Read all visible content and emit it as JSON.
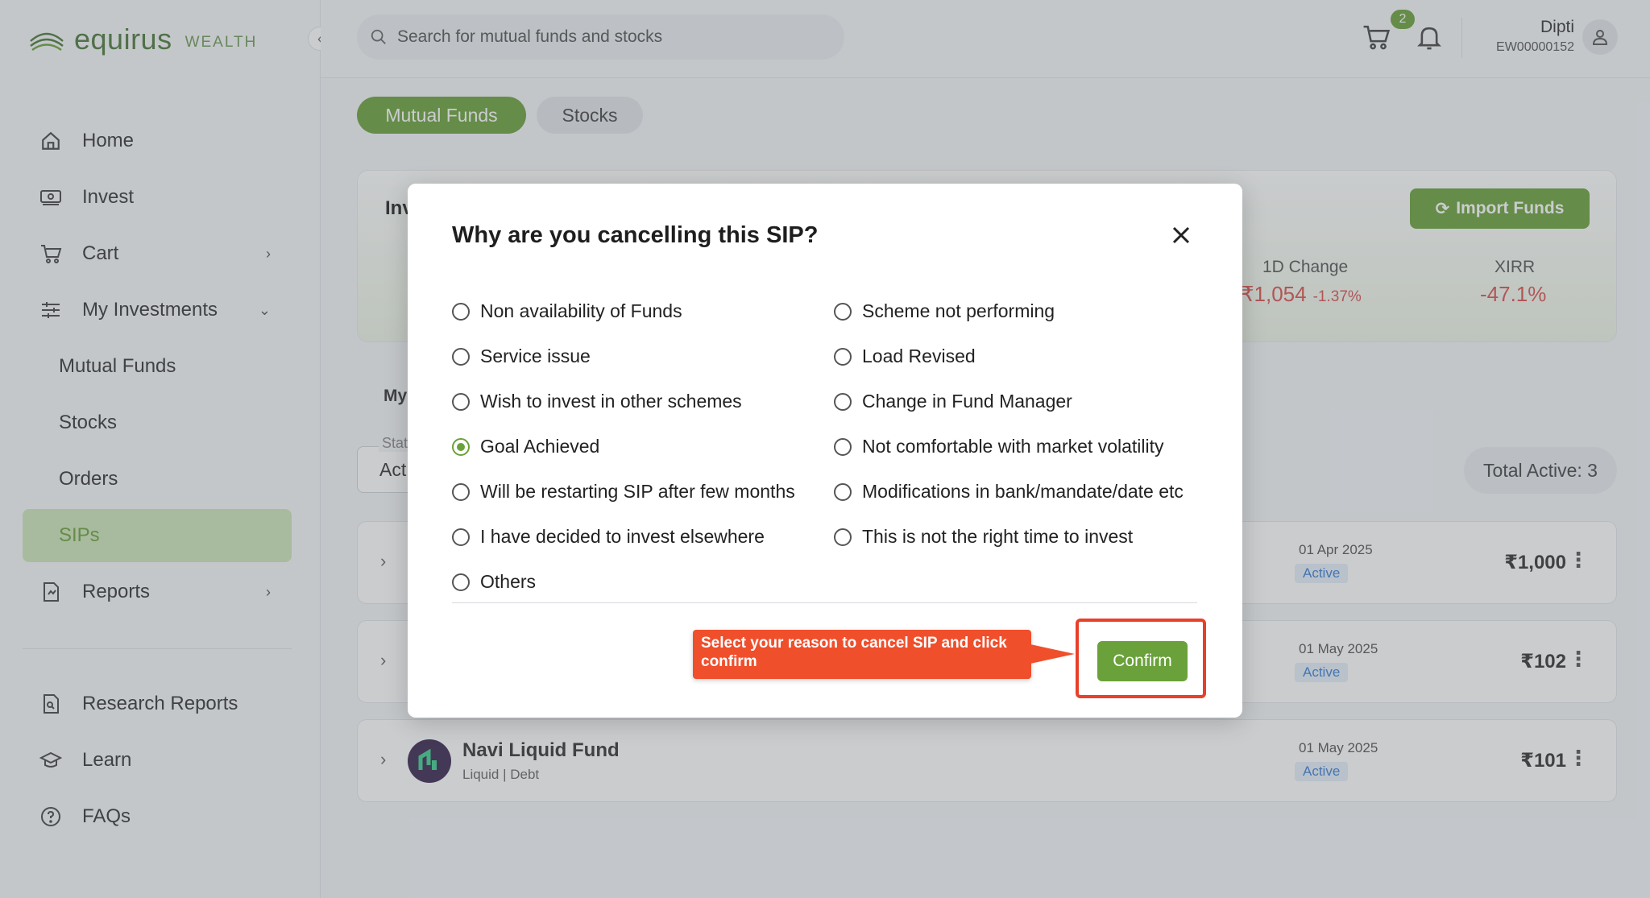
{
  "brand": {
    "name": "equirus",
    "suffix": "WEALTH"
  },
  "sidebar": {
    "items": [
      {
        "label": "Home",
        "icon": "home-icon"
      },
      {
        "label": "Invest",
        "icon": "invest-icon"
      },
      {
        "label": "Cart",
        "icon": "cart-icon"
      },
      {
        "label": "My Investments",
        "icon": "investments-icon"
      },
      {
        "label": "Reports",
        "icon": "reports-icon"
      },
      {
        "label": "Research Reports",
        "icon": "research-icon"
      },
      {
        "label": "Learn",
        "icon": "learn-icon"
      },
      {
        "label": "FAQs",
        "icon": "faq-icon"
      }
    ],
    "sub_items": [
      "Mutual Funds",
      "Stocks",
      "Orders",
      "SIPs"
    ],
    "active_sub": "SIPs"
  },
  "header": {
    "search_placeholder": "Search for mutual funds and stocks",
    "cart_count": "2",
    "user_name": "Dipti",
    "user_id": "EW00000152"
  },
  "tabs": [
    "Mutual Funds",
    "Stocks"
  ],
  "summary": {
    "title_partial": "Inv",
    "import_label": "Import Funds",
    "change_label": "1D Change",
    "change_value": "₹1,054",
    "change_pct": "-1.37%",
    "xirr_label": "XIRR",
    "xirr_value": "-47.1%"
  },
  "list": {
    "section_partial": "My",
    "status_label": "Stat",
    "status_value": "Act",
    "total_active": "Total Active: 3",
    "rows": [
      {
        "date": "01 Apr 2025",
        "status": "Active",
        "amount": "₹1,000"
      },
      {
        "date": "01 May 2025",
        "status": "Active",
        "amount": "₹102"
      },
      {
        "name": "Navi Liquid Fund",
        "category": "Liquid | Debt",
        "date": "01 May 2025",
        "status": "Active",
        "amount": "₹101"
      }
    ]
  },
  "modal": {
    "title": "Why are you cancelling this SIP?",
    "options_left": [
      "Non availability of Funds",
      "Service issue",
      "Wish to invest in other schemes",
      "Goal Achieved",
      "Will be restarting SIP after few months",
      "I have decided to invest elsewhere",
      "Others"
    ],
    "options_right": [
      "Scheme not performing",
      "Load Revised",
      "Change in Fund Manager",
      "Not comfortable with market volatility",
      "Modifications in bank/mandate/date etc",
      "This is not the right time to invest"
    ],
    "selected": "Goal Achieved",
    "confirm_label": "Confirm",
    "callout_text": "Select your reason to cancel SIP and click confirm"
  },
  "colors": {
    "accent": "#6aa13a",
    "negative": "#d9534f",
    "callout": "#f04f2c"
  }
}
